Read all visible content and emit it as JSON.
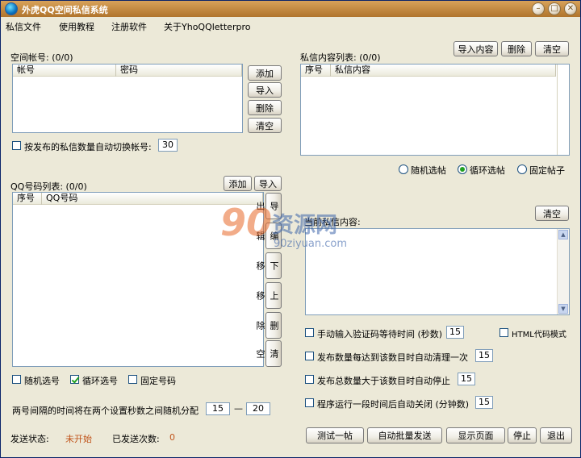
{
  "window": {
    "title": "外虎QQ空间私信系统",
    "min_icon": "minimize-icon",
    "max_icon": "maximize-icon",
    "close_icon": "close-icon"
  },
  "menu": [
    "私信文件",
    "使用教程",
    "注册软件",
    "关于YhoQQletterpro"
  ],
  "accounts": {
    "label": "空间帐号: (0/0)",
    "columns": [
      "帐号",
      "密码"
    ],
    "buttons": [
      "添加",
      "导入",
      "删除",
      "清空"
    ],
    "auto_switch_label": "按发布的私信数量自动切换帐号:",
    "auto_switch_value": "30",
    "auto_switch_checked": false
  },
  "messages": {
    "label": "私信内容列表: (0/0)",
    "columns": [
      "序号",
      "私信内容"
    ],
    "buttons": [
      "导入内容",
      "删除",
      "清空"
    ],
    "mode_options": [
      "随机选帖",
      "循环选帖",
      "固定帖子"
    ],
    "mode_selected": 1
  },
  "qq_list": {
    "label": "QQ号码列表: (0/0)",
    "columns": [
      "序号",
      "QQ号码"
    ],
    "top_buttons": [
      "添加",
      "导入"
    ],
    "side_buttons": [
      "导出",
      "编辑",
      "下移",
      "上移",
      "删除",
      "清空"
    ],
    "select_options": [
      "随机选号",
      "循环选号",
      "固定号码"
    ],
    "select_checked": [
      false,
      true,
      false
    ],
    "interval_label": "两号间隔的时间将在两个设置秒数之间随机分配",
    "interval_min": "15",
    "interval_sep": "—",
    "interval_max": "20"
  },
  "current": {
    "label": "当前私信内容:",
    "clear_button": "清空"
  },
  "options": {
    "items": [
      {
        "label": "手动输入验证码等待时间 (秒数)",
        "value": "15",
        "checked": false
      },
      {
        "label": "发布数量每达到该数目时自动清理一次",
        "value": "15",
        "checked": false
      },
      {
        "label": "发布总数量大于该数目时自动停止",
        "value": "15",
        "checked": false
      },
      {
        "label": "程序运行一段时间后自动关闭 (分钟数)",
        "value": "15",
        "checked": false
      }
    ],
    "html_mode_label": "HTML代码模式",
    "html_mode_checked": false
  },
  "status": {
    "label": "发送状态:",
    "value": "未开始",
    "count_label": "已发送次数:",
    "count_value": "0"
  },
  "bottom_buttons": [
    "测试一帖",
    "自动批量发送",
    "显示页面",
    "停止",
    "退出"
  ],
  "watermark": {
    "number": "90",
    "text": "资源网",
    "url": "90ziyuan.com"
  },
  "colors": {
    "title_bar": "#c08a44",
    "status_value": "#c0541b",
    "check_green": "#21a121"
  }
}
